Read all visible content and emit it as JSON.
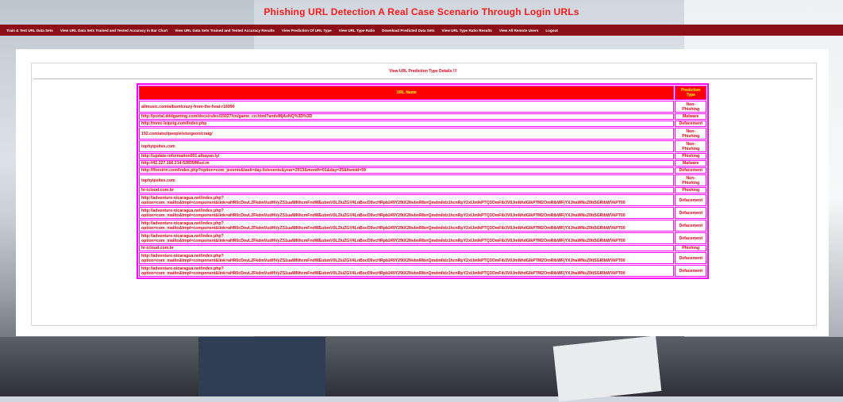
{
  "app": {
    "title": "Phishing URL Detection A Real Case Scenario Through Login URLs"
  },
  "nav": [
    "Train & Test URL Data Sets",
    "View URL Data Sets Trained and Tested Accuracy in Bar Chart",
    "View URL Data Sets Trained and Tested Accuracy Results",
    "View Prediction Of URL Type",
    "View URL Type Ratio",
    "Download Predicted Data Sets",
    "View URL Type Ratio Results",
    "View All Remote Users",
    "Logout"
  ],
  "panel": {
    "title": "View URL Prediction Type Details !!!"
  },
  "table": {
    "headers": {
      "url": "URL Name",
      "type": "Prediction Type"
    },
    "rows": [
      {
        "url": "allmusic.com/album/crazy-from-the-heat-r16990",
        "type": "Non-Phishing"
      },
      {
        "url": "http://portal.dddgaming.com/docs/rules/15027/cn/game_cn.html?amluMjAxNQ%3D%3D",
        "type": "Malware"
      },
      {
        "url": "http://mmc-leipzig.com/index.php",
        "type": "Defacement"
      },
      {
        "url": "192.com/atoz/people/sturgeon/craig/",
        "type": "Non-Phishing"
      },
      {
        "url": "tophyipsites.com",
        "type": "Non-Phishing"
      },
      {
        "url": "http://update-information001.albayan.ly/",
        "type": "Phishing"
      },
      {
        "url": "http://42.227.166.214:52835/Mozi.m",
        "type": "Malware"
      },
      {
        "url": "http://lforsirin.com/index.php?option=com_jevents&task=day.listevents&year=2013&month=01&day=25&Itemid=59",
        "type": "Defacement"
      },
      {
        "url": "tophyipsites.com",
        "type": "Non-Phishing"
      },
      {
        "url": "hr-icloud.com.br",
        "type": "Phishing"
      },
      {
        "url": "http://adventure-nicaragua.net/index.php?option=com_mailto&tmpl=component&link=aHR0cDovL2FkdmVudHVyZS1uaWNhcmFndWEubmV0L2luZGV4LnBocD9vcHRpb249Y29tX2NvbnRlbnQmdmlldz1hcnRpY2xlJmlkPTQ3OmFib3V0JmNhdGlkPTM2OmRibWFjYXJhaWNsZ0ltSGRlbWVkPT00",
        "type": "Defacement"
      },
      {
        "url": "http://adventure-nicaragua.net/index.php?option=com_mailto&tmpl=component&link=aHR0cDovL2FkdmVudHVyZS1uaWNhcmFndWEubmV0L2luZGV4LnBocD9vcHRpb249Y29tX2NvbnRlbnQmdmlldz1hcnRpY2xlJmlkPTQ3OmFib3V0JmNhdGlkPTM2OmRibWFjYXJhaWNsZ0ltSGRlbWVkPT00",
        "type": "Defacement"
      },
      {
        "url": "http://adventure-nicaragua.net/index.php?option=com_mailto&tmpl=component&link=aHR0cDovL2FkdmVudHVyZS1uaWNhcmFndWEubmV0L2luZGV4LnBocD9vcHRpb249Y29tX2NvbnRlbnQmdmlldz1hcnRpY2xlJmlkPTQ3OmFib3V0JmNhdGlkPTM2OmRibWFjYXJhaWNsZ0ltSGRlbWVkPT00",
        "type": "Defacement"
      },
      {
        "url": "http://adventure-nicaragua.net/index.php?option=com_mailto&tmpl=component&link=aHR0cDovL2FkdmVudHVyZS1uaWNhcmFndWEubmV0L2luZGV4LnBocD9vcHRpb249Y29tX2NvbnRlbnQmdmlldz1hcnRpY2xlJmlkPTQ3OmFib3V0JmNhdGlkPTM2OmRibWFjYXJhaWNsZ0ltSGRlbWVkPT00",
        "type": "Defacement"
      },
      {
        "url": "hr-icloud.com.br",
        "type": "Phishing"
      },
      {
        "url": "http://adventure-nicaragua.net/index.php?option=com_mailto&tmpl=component&link=aHR0cDovL2FkdmVudHVyZS1uaWNhcmFndWEubmV0L2luZGV4LnBocD9vcHRpb249Y29tX2NvbnRlbnQmdmlldz1hcnRpY2xlJmlkPTQ3OmFib3V0JmNhdGlkPTM2OmRibWFjYXJhaWNsZ0ltSGRlbWVkPT00",
        "type": "Defacement"
      },
      {
        "url": "http://adventure-nicaragua.net/index.php?option=com_mailto&tmpl=component&link=aHR0cDovL2FkdmVudHVyZS1uaWNhcmFndWEubmV0L2luZGV4LnBocD9vcHRpb249Y29tX2NvbnRlbnQmdmlldz1hcnRpY2xlJmlkPTQ3OmFib3V0JmNhdGlkPTM2OmRibWFjYXJhaWNsZ0ltSGRlbWVkPT00",
        "type": "Defacement"
      }
    ]
  },
  "colors": {
    "title": "#ff1a1a",
    "nav_bg": "#8c0f19",
    "table_border": "#ff00ff",
    "header_bg": "#ff0000",
    "header_text": "#ffff00",
    "cell_text": "#e0001b"
  }
}
